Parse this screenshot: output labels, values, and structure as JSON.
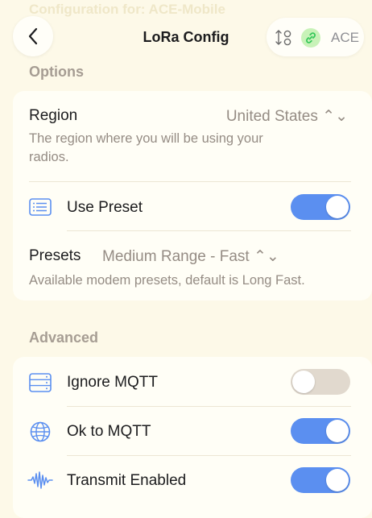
{
  "header": {
    "faded_title": "Configuration for: ACE-Mobile",
    "title": "LoRa Config",
    "node_short_name": "ACE"
  },
  "options": {
    "section_title": "Options",
    "region": {
      "label": "Region",
      "value": "United States ⌃⌄",
      "description": "The region where you will be using your radios."
    },
    "use_preset": {
      "label": "Use Preset",
      "enabled": true
    },
    "presets": {
      "label": "Presets",
      "value": "Medium Range - Fast ⌃⌄",
      "description": "Available modem presets, default is Long Fast."
    }
  },
  "advanced": {
    "section_title": "Advanced",
    "ignore_mqtt": {
      "label": "Ignore MQTT",
      "enabled": false
    },
    "ok_to_mqtt": {
      "label": "Ok to MQTT",
      "enabled": true
    },
    "transmit_enabled": {
      "label": "Transmit Enabled",
      "enabled": true
    }
  },
  "colors": {
    "accent": "#5b8ff0",
    "background": "#fdf9e8",
    "toggle_off": "#e1d9ce",
    "link_badge": "#c8f2b8"
  },
  "icons": {
    "back": "chevron-left-icon",
    "sort": "sort-arrows-icon",
    "link": "link-icon",
    "use_preset": "list-icon",
    "ignore_mqtt": "server-icon",
    "ok_to_mqtt": "globe-icon",
    "transmit_enabled": "waveform-icon"
  }
}
